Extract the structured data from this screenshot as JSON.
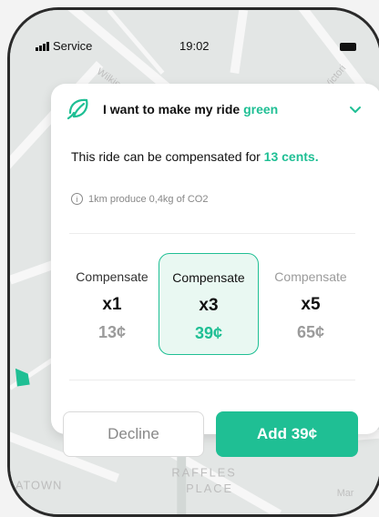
{
  "status_bar": {
    "carrier": "Service",
    "time": "19:02"
  },
  "map": {
    "streets": [
      "Wilkie R",
      "Victori",
      "N",
      "CI",
      "ay",
      "ATOWN",
      "RAFFLES",
      "PLACE",
      "Mar"
    ]
  },
  "card": {
    "header": {
      "title_prefix": "I want to make my ride ",
      "title_accent": "green"
    },
    "description_prefix": "This ride can be compensated for ",
    "description_amount": "13 cents.",
    "info_text": "1km produce 0,4kg of CO2",
    "options": [
      {
        "label": "Compensate",
        "multiplier": "x1",
        "price": "13¢"
      },
      {
        "label": "Compensate",
        "multiplier": "x3",
        "price": "39¢"
      },
      {
        "label": "Compensate",
        "multiplier": "x5",
        "price": "65¢"
      }
    ],
    "selected_option": "x3",
    "decline_label": "Decline",
    "add_label": "Add 39¢"
  },
  "colors": {
    "accent": "#1fbf94",
    "selected_bg": "#e9f8f2",
    "map_bg": "#e3e6e5"
  }
}
